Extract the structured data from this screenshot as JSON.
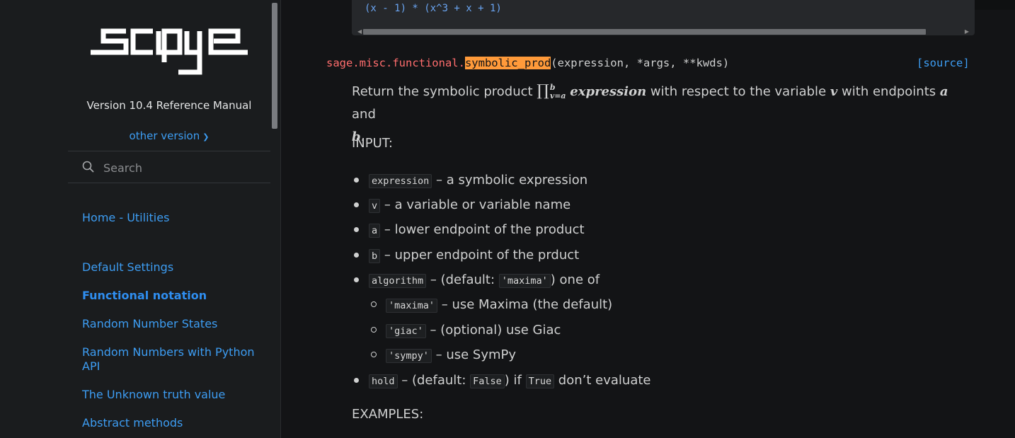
{
  "sidebar": {
    "version": "Version 10.4 Reference Manual",
    "other_version": "other version",
    "search_placeholder": "Search",
    "nav": [
      "Home - Utilities",
      "Default Settings",
      "Functional notation",
      "Random Number States",
      "Random Numbers with Python API",
      "The Unknown truth value",
      "Abstract methods"
    ],
    "active_index": 2
  },
  "code_block": {
    "line": "(x - 1) * (x^3 + x + 1)"
  },
  "signature": {
    "prefix": "sage.misc.functional.",
    "name": "symbolic_prod",
    "params": "(expression, *args, **kwds)",
    "source_label": "[source]"
  },
  "description": {
    "pre": "Return the symbolic product ",
    "prod_symbol": "∏",
    "upper": "b",
    "lower": "v=a",
    "expr": "expression",
    "mid1": " with respect to the variable ",
    "var_v": "v",
    "mid2": " with endpoints ",
    "var_a": "a",
    "mid3": " and",
    "var_b": "b",
    "end": "."
  },
  "input_heading": "INPUT:",
  "inputs": {
    "expression": {
      "code": "expression",
      "text": " – a symbolic expression"
    },
    "v": {
      "code": "v",
      "text": " – a variable or variable name"
    },
    "a": {
      "code": "a",
      "text": " – lower endpoint of the product"
    },
    "b": {
      "code": "b",
      "text": " – upper endpoint of the prduct"
    },
    "algorithm": {
      "code": "algorithm",
      "t1": " – (default: ",
      "default_code": "'maxima'",
      "t2": ") one of",
      "options": [
        {
          "code": "'maxima'",
          "text": " – use Maxima (the default)"
        },
        {
          "code": "'giac'",
          "text": " – (optional) use Giac"
        },
        {
          "code": "'sympy'",
          "text": " – use SymPy"
        }
      ]
    },
    "hold": {
      "code": "hold",
      "t1": " – (default: ",
      "code2": "False",
      "t2": ") if ",
      "code3": "True",
      "t3": " don’t evaluate"
    }
  },
  "examples_heading": "EXAMPLES:"
}
